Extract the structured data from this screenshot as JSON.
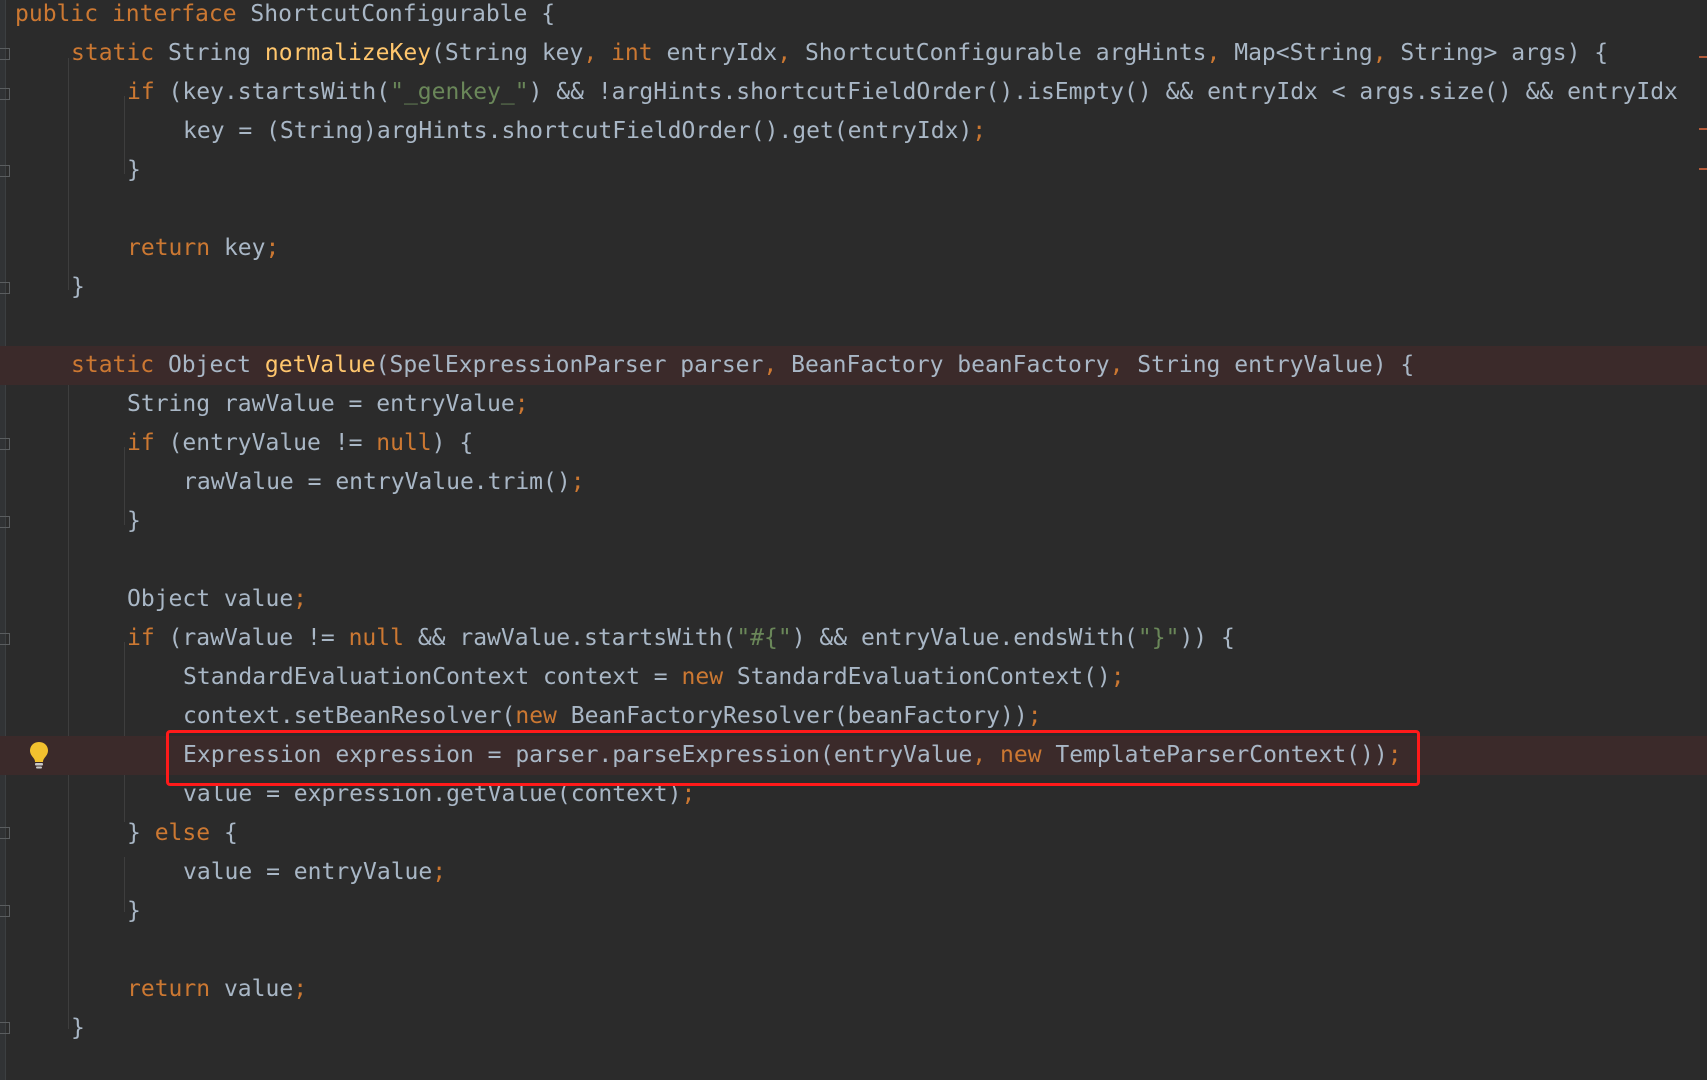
{
  "colors": {
    "background": "#2b2b2b",
    "keyword": "#cc7832",
    "method": "#ffc66d",
    "string": "#6a8759",
    "text": "#a9b7c6",
    "highlight_line": "#3b2a2a",
    "annotation_box": "#ff1a1a"
  },
  "icons": {
    "bulb": "lightbulb-icon"
  },
  "code": {
    "l1": {
      "kw1": "public",
      "kw2": "interface",
      "rest": " ShortcutConfigurable {"
    },
    "l2": {
      "kw": "static",
      "t1": " String ",
      "fn": "normalizeKey",
      "t2": "(String key",
      "c1": ",",
      "kw2": " int",
      "t3": " entryIdx",
      "c2": ",",
      "t4": " ShortcutConfigurable argHints",
      "c3": ",",
      "t5": " Map<String",
      "c4": ",",
      "t6": " String> args) {"
    },
    "l3": {
      "kw": "if",
      "t1": " (key.startsWith(",
      "str": "\"_genkey_\"",
      "t2": ") && !argHints.shortcutFieldOrder().isEmpty() && entryIdx < args.size() && entryIdx"
    },
    "l4": {
      "t1": "key = (String)argHints.shortcutFieldOrder().get(entryIdx)",
      "semi": ";"
    },
    "l5": {
      "t1": "}"
    },
    "l7": {
      "kw": "return",
      "t1": " key",
      "semi": ";"
    },
    "l8": {
      "t1": "}"
    },
    "l10": {
      "kw": "static",
      "t1": " Object ",
      "fn": "getValue",
      "t2": "(SpelExpressionParser parser",
      "c1": ",",
      "t3": " BeanFactory beanFactory",
      "c2": ",",
      "t4": " String entryValue) {"
    },
    "l11": {
      "t1": "String rawValue = entryValue",
      "semi": ";"
    },
    "l12": {
      "kw": "if",
      "t1": " (entryValue != ",
      "kw2": "null",
      "t2": ") {"
    },
    "l13": {
      "t1": "rawValue = entryValue.trim()",
      "semi": ";"
    },
    "l14": {
      "t1": "}"
    },
    "l16": {
      "t1": "Object value",
      "semi": ";"
    },
    "l17": {
      "kw": "if",
      "t1": " (rawValue != ",
      "kw2": "null",
      "t2": " && rawValue.startsWith(",
      "str1": "\"#{\"",
      "t3": ") && entryValue.endsWith(",
      "str2": "\"}\"",
      "t4": ")) {"
    },
    "l18": {
      "t1": "StandardEvaluationContext context = ",
      "kw": "new",
      "t2": " StandardEvaluationContext()",
      "semi": ";"
    },
    "l19": {
      "t1": "context.setBeanResolver(",
      "kw": "new",
      "t2": " BeanFactoryResolver(beanFactory))",
      "semi": ";"
    },
    "l20": {
      "t1": "Expression expression = parser.parseExpression(entryValue",
      "c1": ",",
      "kw": " new",
      "t2": " TemplateParserContext())",
      "semi": ";"
    },
    "l21": {
      "t1": "value = expression.getValue(context)",
      "semi": ";"
    },
    "l22": {
      "t1": "} ",
      "kw": "else",
      "t2": " {"
    },
    "l23": {
      "t1": "value = entryValue",
      "semi": ";"
    },
    "l24": {
      "t1": "}"
    },
    "l26": {
      "kw": "return",
      "t1": " value",
      "semi": ";"
    },
    "l27": {
      "t1": "}"
    }
  }
}
